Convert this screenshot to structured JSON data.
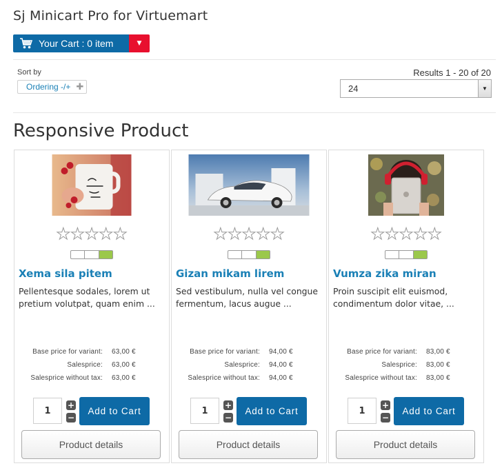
{
  "module": {
    "title": "Sj Minicart Pro for Virtuemart",
    "cart_label": "Your Cart : 0 item",
    "cart_icon": "cart-icon",
    "dropdown_icon": "caret-down-icon",
    "cart_color": "#0e6aa6",
    "dropdown_color": "#e8102e"
  },
  "toolbar": {
    "sort_by_label": "Sort by",
    "ordering_label": "Ordering -/+",
    "ordering_icon": "plus-icon",
    "results_text": "Results 1 - 20 of 20",
    "limit_value": "24"
  },
  "section_title": "Responsive Product",
  "products": [
    {
      "title": "Xema sila pitem",
      "description": "Pellentesque sodales, lorem ut pretium volutpat, quam enim ...",
      "image": "mug-image",
      "rating": 0,
      "prices": [
        {
          "label": "Base price for variant:",
          "value": "63,00 €"
        },
        {
          "label": "Salesprice:",
          "value": "63,00 €"
        },
        {
          "label": "Salesprice without tax:",
          "value": "63,00 €"
        }
      ],
      "quantity": "1",
      "add_label": "Add to Cart",
      "details_label": "Product details"
    },
    {
      "title": "Gizan mikam lirem",
      "description": "Sed vestibulum, nulla vel congue fermentum, lacus augue ...",
      "image": "car-image",
      "rating": 0,
      "prices": [
        {
          "label": "Base price for variant:",
          "value": "94,00 €"
        },
        {
          "label": "Salesprice:",
          "value": "94,00 €"
        },
        {
          "label": "Salesprice without tax:",
          "value": "94,00 €"
        }
      ],
      "quantity": "1",
      "add_label": "Add to Cart",
      "details_label": "Product details"
    },
    {
      "title": "Vumza zika miran",
      "description": "Proin suscipit elit euismod, condimentum dolor vitae, ...",
      "image": "tablet-image",
      "rating": 0,
      "prices": [
        {
          "label": "Base price for variant:",
          "value": "83,00 €"
        },
        {
          "label": "Salesprice:",
          "value": "83,00 €"
        },
        {
          "label": "Salesprice without tax:",
          "value": "83,00 €"
        }
      ],
      "quantity": "1",
      "add_label": "Add to Cart",
      "details_label": "Product details"
    }
  ],
  "colors": {
    "accent": "#1a80b6",
    "button": "#0e6aa6",
    "stock_fill": "#9bc84b"
  }
}
